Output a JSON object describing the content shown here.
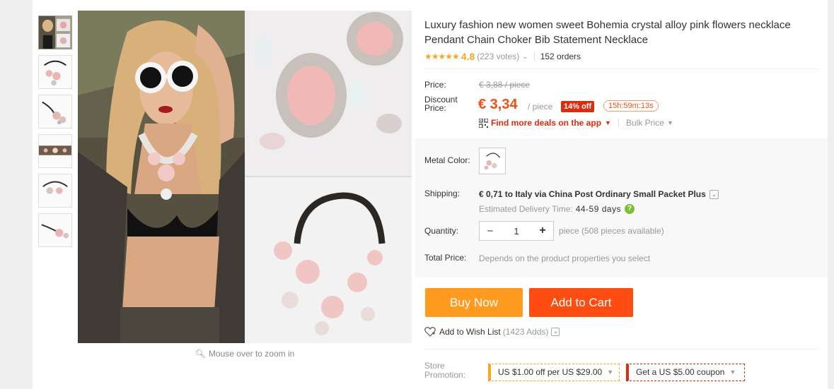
{
  "product": {
    "title": "Luxury fashion new women sweet Bohemia crystal alloy pink flowers necklace Pendant Chain Choker Bib Statement Necklace",
    "stars": "★★★★★",
    "rating": "4.8",
    "votes": "(223 votes)",
    "orders": "152 orders"
  },
  "gallery": {
    "thumbnails": [
      "model-photo",
      "necklace-photo",
      "necklace-photo",
      "necklace-strip-photo",
      "necklace-photo",
      "necklace-photo"
    ],
    "zoom_hint": "Mouse over to zoom in"
  },
  "price": {
    "price_label": "Price:",
    "original": "€ 3,88 / piece",
    "discount_label": "Discount\nPrice:",
    "discount_price": "€ 3,34",
    "per_piece": "/ piece",
    "off_badge": "14% off",
    "timer": "15h:59m:13s",
    "deals_link": "Find more deals on the app",
    "bulk_price": "Bulk Price"
  },
  "properties": {
    "metal_color_label": "Metal Color:",
    "shipping_label": "Shipping:",
    "shipping_value": "€ 0,71 to Italy via China Post Ordinary Small Packet Plus",
    "delivery_label": "Estimated Delivery Time:",
    "delivery_days": "44-59 days",
    "quantity_label": "Quantity:",
    "quantity_minus": "−",
    "quantity_value": "1",
    "quantity_plus": "+",
    "quantity_available": "piece (508 pieces available)",
    "total_label": "Total Price:",
    "total_value": "Depends on the product properties you select"
  },
  "actions": {
    "buy_now": "Buy Now",
    "add_to_cart": "Add to Cart",
    "wish_list": "Add to Wish List",
    "wish_count": "(1423 Adds)"
  },
  "promotion": {
    "label": "Store\nPromotion:",
    "coupon1": "US $1.00 off per US $29.00",
    "coupon2": "Get a US $5.00 coupon"
  },
  "colors": {
    "accent_orange": "#ff9b1f",
    "accent_red": "#ff4d11",
    "price_red": "#f05012",
    "star_gold": "#f5a623"
  }
}
